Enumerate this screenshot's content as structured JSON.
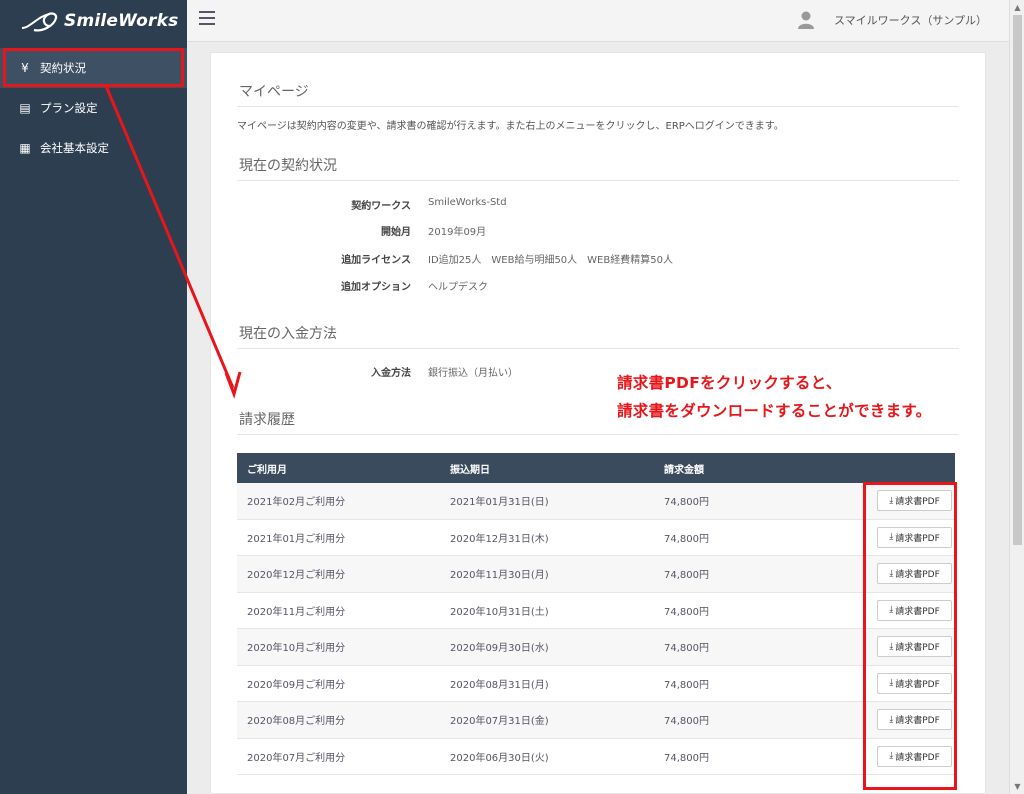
{
  "brand": {
    "name": "SmileWorks"
  },
  "sidebar": {
    "items": [
      {
        "icon": "yen-icon",
        "glyph": "¥",
        "label": "契約状況"
      },
      {
        "icon": "list-icon",
        "glyph": "▤",
        "label": "プラン設定"
      },
      {
        "icon": "building-icon",
        "glyph": "▦",
        "label": "会社基本設定"
      }
    ]
  },
  "topbar": {
    "user_name": "スマイルワークス（サンプル）"
  },
  "mypage": {
    "title": "マイページ",
    "intro": "マイページは契約内容の変更や、請求書の確認が行えます。また右上のメニューをクリックし、ERPへログインできます。"
  },
  "contract": {
    "title": "現在の契約状況",
    "rows": [
      {
        "label": "契約ワークス",
        "value": "SmileWorks-Std"
      },
      {
        "label": "開始月",
        "value": "2019年09月"
      },
      {
        "label": "追加ライセンス",
        "value": "ID追加25人　WEB給与明細50人　WEB経費精算50人"
      },
      {
        "label": "追加オプション",
        "value": "ヘルプデスク"
      }
    ]
  },
  "payment": {
    "title": "現在の入金方法",
    "label": "入金方法",
    "value": "銀行振込（月払い）"
  },
  "annotation": {
    "line1": "請求書PDFをクリックすると、",
    "line2": "請求書をダウンロードすることができます。",
    "color": "#e8161b"
  },
  "history": {
    "title": "請求履歴",
    "headers": [
      "ご利用月",
      "振込期日",
      "請求金額",
      ""
    ],
    "pdf_label": "請求書PDF",
    "rows": [
      {
        "month": "2021年02月ご利用分",
        "due": "2021年01月31日(日)",
        "amount": "74,800円"
      },
      {
        "month": "2021年01月ご利用分",
        "due": "2020年12月31日(木)",
        "amount": "74,800円"
      },
      {
        "month": "2020年12月ご利用分",
        "due": "2020年11月30日(月)",
        "amount": "74,800円"
      },
      {
        "month": "2020年11月ご利用分",
        "due": "2020年10月31日(土)",
        "amount": "74,800円"
      },
      {
        "month": "2020年10月ご利用分",
        "due": "2020年09月30日(水)",
        "amount": "74,800円"
      },
      {
        "month": "2020年09月ご利用分",
        "due": "2020年08月31日(月)",
        "amount": "74,800円"
      },
      {
        "month": "2020年08月ご利用分",
        "due": "2020年07月31日(金)",
        "amount": "74,800円"
      },
      {
        "month": "2020年07月ご利用分",
        "due": "2020年06月30日(火)",
        "amount": "74,800円"
      }
    ]
  },
  "colors": {
    "sidebar_bg": "#2c3e50",
    "table_header_bg": "#3a4b5e",
    "highlight": "#e8161b"
  }
}
